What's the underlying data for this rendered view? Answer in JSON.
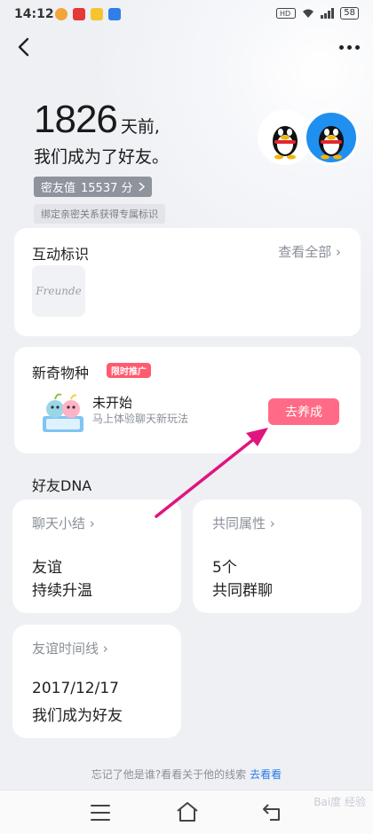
{
  "status_bar": {
    "time": "14:12",
    "battery": "58"
  },
  "hero": {
    "days_number": "1826",
    "days_unit": "天前,",
    "friends_text": "我们成为了好友。",
    "intimacy_label": "密友值",
    "intimacy_value": "15537 分",
    "bind_hint": "绑定亲密关系获得专属标识"
  },
  "interaction_card": {
    "title": "互动标识",
    "view_all": "查看全部 ›",
    "badge_text": "Freunde"
  },
  "species_card": {
    "title": "新奇物种",
    "promo_tag": "限时推广",
    "status": "未开始",
    "desc": "马上体验聊天新玩法",
    "action": "去养成"
  },
  "dna_section": {
    "title": "好友DNA",
    "summary": {
      "label": "聊天小结 ›",
      "line1": "友谊",
      "line2": "持续升温"
    },
    "attributes": {
      "label": "共同属性 ›",
      "line1": "5个",
      "line2": "共同群聊"
    },
    "timeline": {
      "label": "友谊时间线 ›",
      "line1": "2017/12/17",
      "line2": "我们成为好友"
    }
  },
  "hint": {
    "text": "忘记了他是谁?看看关于他的线索",
    "link": "去看看"
  },
  "watermark": "Bai度 经验",
  "colors": {
    "accent_pink": "#ff6b86",
    "promo_red": "#ff5a6e",
    "link_blue": "#2a7ae8",
    "arrow_magenta": "#e0157e"
  }
}
